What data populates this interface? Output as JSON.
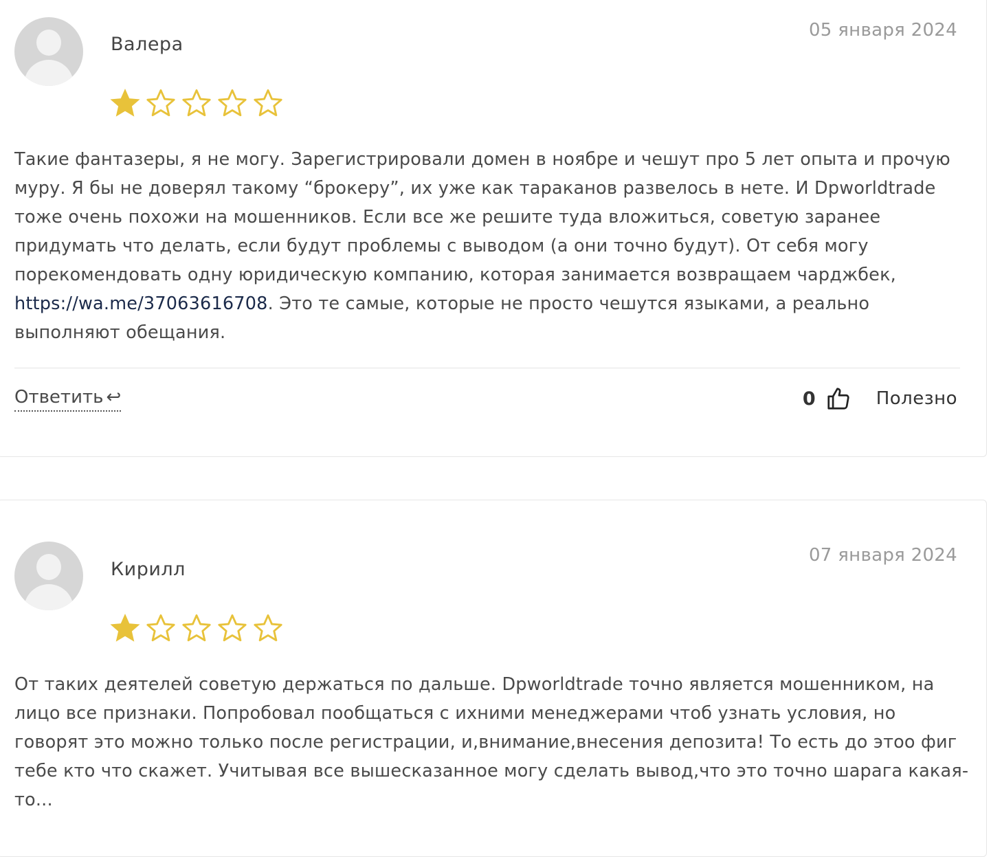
{
  "colors": {
    "star_fill": "#e8c23a",
    "star_outline": "#e8c23a",
    "text": "#4a4a4a",
    "date": "#9a9a9a",
    "link": "#1b2a4a"
  },
  "reviews": [
    {
      "author": "Валера",
      "date": "05 января 2024",
      "rating": 1,
      "max_rating": 5,
      "text_before_link": "Такие фантазеры, я не могу. Зарегистрировали домен в ноябре и чешут про 5 лет опыта и прочую муру. Я бы не доверял такому “брокеру”, их уже как тараканов развелось в нете. И Dpworldtrade тоже очень похожи на мошенников. Если все же решите туда вложиться, советую заранее придумать что делать, если будут проблемы с выводом (а они точно будут). От себя могу порекомендовать одну юридическую компанию, которая занимается возвращаем чарджбек, ",
      "link": "https://wa.me/37063616708",
      "text_after_link": ". Это те самые, которые не просто чешутся языками, а реально выполняют обещания.",
      "reply_label": "Ответить",
      "reply_icon": "reply-arrow-icon",
      "useful_count": "0",
      "useful_label": "Полезно"
    },
    {
      "author": "Кирилл",
      "date": "07 января 2024",
      "rating": 1,
      "max_rating": 5,
      "text": "От таких деятелей советую держаться по дальше. Dpworldtrade точно является мошенником, на лицо все признаки. Попробовал пообщаться с ихними менеджерами чтоб узнать условия, но говорят это можно только после регистрации, и,внимание,внесения депозита! То есть до этоо фиг тебе кто что скажет. Учитывая все вышесказанное могу сделать вывод,что это точно шарага какая-то..."
    }
  ]
}
